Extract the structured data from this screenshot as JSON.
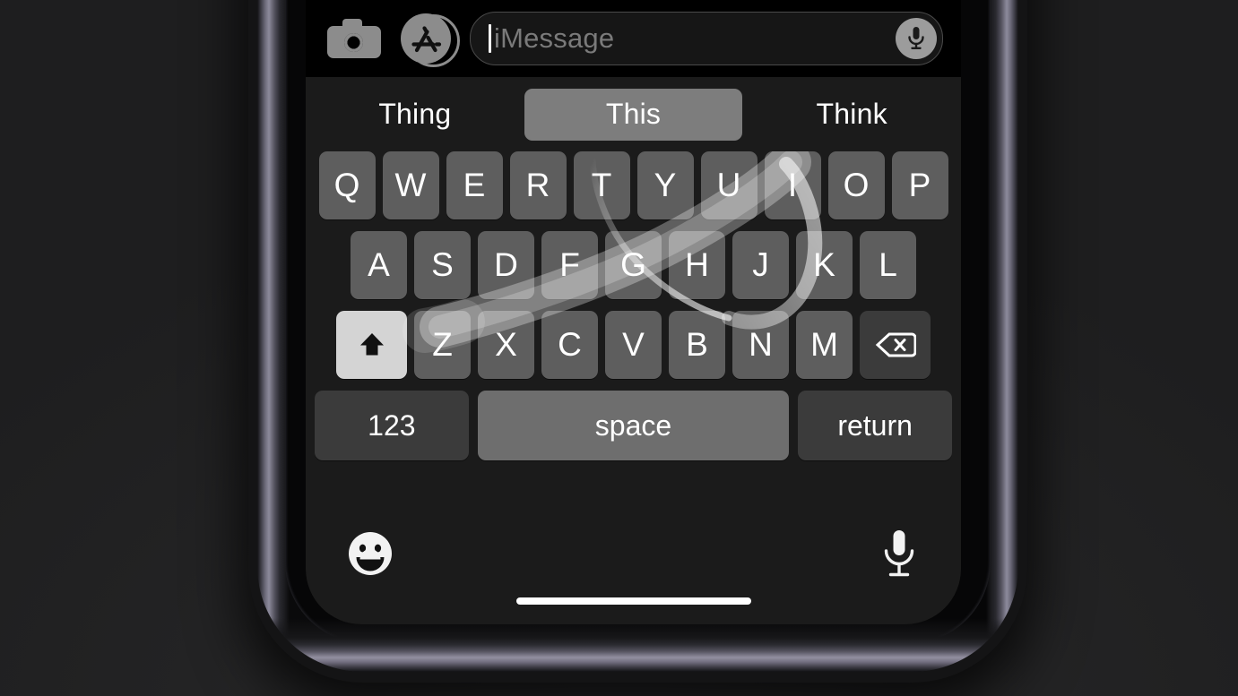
{
  "device": {
    "name": "iphone",
    "frame_color": "#0a0a0b",
    "band_highlight": "#8d8b9c",
    "backdrop_color": "#232323"
  },
  "screen": {
    "background": "#000000",
    "keyboard_background": "#1b1b1b"
  },
  "input_bar": {
    "camera_icon": "camera-icon",
    "appstore_icon": "app-store-icon",
    "field_placeholder": "iMessage",
    "field_value": "",
    "caret_visible": true,
    "mic_icon": "microphone-icon",
    "placeholder_color": "#7a7a7a",
    "field_border_color": "#4a4a4a"
  },
  "prediction_bar": {
    "suggestions": [
      {
        "label": "Thing",
        "selected": false
      },
      {
        "label": "This",
        "selected": true
      },
      {
        "label": "Think",
        "selected": false
      }
    ],
    "selected_background": "#7d7d7d"
  },
  "keyboard": {
    "language": "English (US)",
    "layout": "QWERTY",
    "shift_state": "on",
    "key_color": "#5e5e5e",
    "function_key_color": "#3b3b3b",
    "shift_active_color": "#d4d4d4",
    "space_key_color": "#6e6e6e",
    "rows": [
      {
        "name": "row-1",
        "keys": [
          "Q",
          "W",
          "E",
          "R",
          "T",
          "Y",
          "U",
          "I",
          "O",
          "P"
        ]
      },
      {
        "name": "row-2",
        "keys": [
          "A",
          "S",
          "D",
          "F",
          "G",
          "H",
          "J",
          "K",
          "L"
        ]
      },
      {
        "name": "row-3",
        "keys": [
          "Z",
          "X",
          "C",
          "V",
          "B",
          "N",
          "M"
        ]
      }
    ],
    "shift_key": {
      "name": "shift-key",
      "icon": "shift-arrow-icon",
      "label": ""
    },
    "backspace_key": {
      "name": "backspace-key",
      "icon": "backspace-icon",
      "label": ""
    },
    "function_row": {
      "numbers_label": "123",
      "space_label": "space",
      "return_label": "return"
    }
  },
  "swipe_gesture": {
    "active": true,
    "word_being_typed": "This",
    "trail_color": "#e6e6e6",
    "path_keys": [
      "T",
      "H",
      "I",
      "S"
    ]
  },
  "bottom_bar": {
    "emoji_button": "emoji-icon",
    "dictation_button": "microphone-icon",
    "home_indicator": "home-indicator"
  }
}
